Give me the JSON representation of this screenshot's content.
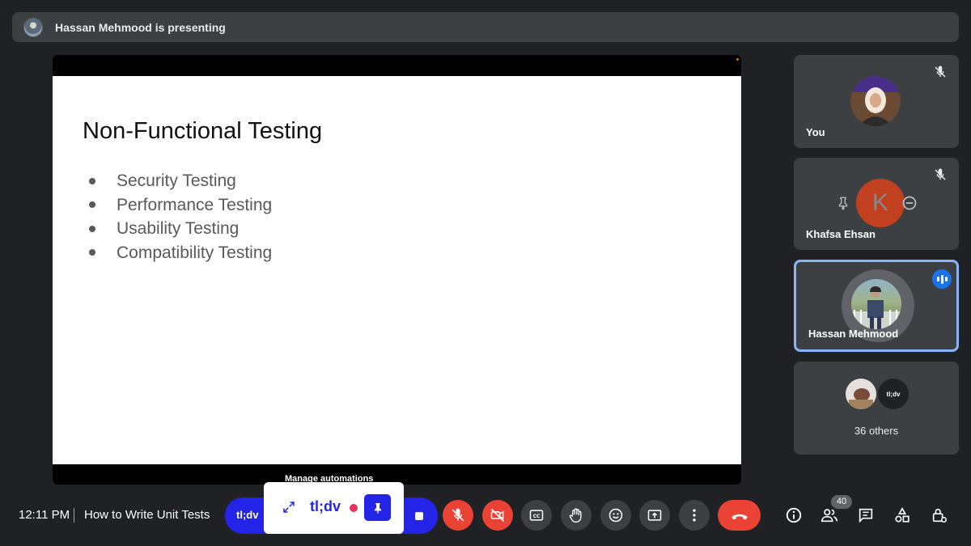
{
  "banner": {
    "text": "Hassan Mehmood is presenting",
    "avatar_icon": "presenter-avatar"
  },
  "slide": {
    "title": "Non-Functional Testing",
    "bullets": [
      "Security Testing",
      "Performance Testing",
      "Usability Testing",
      "Compatibility Testing"
    ]
  },
  "participants": {
    "you": {
      "name": "You",
      "muted": true
    },
    "khafsa": {
      "name": "Khafsa Ehsan",
      "initial": "K",
      "muted": true,
      "avatar_color": "#c1401f"
    },
    "hassan": {
      "name": "Hassan Mehmood",
      "speaking": true
    },
    "others": {
      "label": "36 others",
      "tldv_label": "tl;dv"
    }
  },
  "bottom_bar": {
    "time": "12:11 PM",
    "meeting_title": "How to Write Unit Tests",
    "participant_count": "40"
  },
  "tldv": {
    "pill_label": "tl;dv",
    "popup_logo": "tl;dv",
    "tooltip": "Manage automations",
    "brand_color": "#2424e8",
    "record_color": "#e8335e"
  },
  "colors": {
    "end_call": "#ea4335",
    "speaking": "#1a73e8",
    "active_border": "#8ab4f8"
  }
}
